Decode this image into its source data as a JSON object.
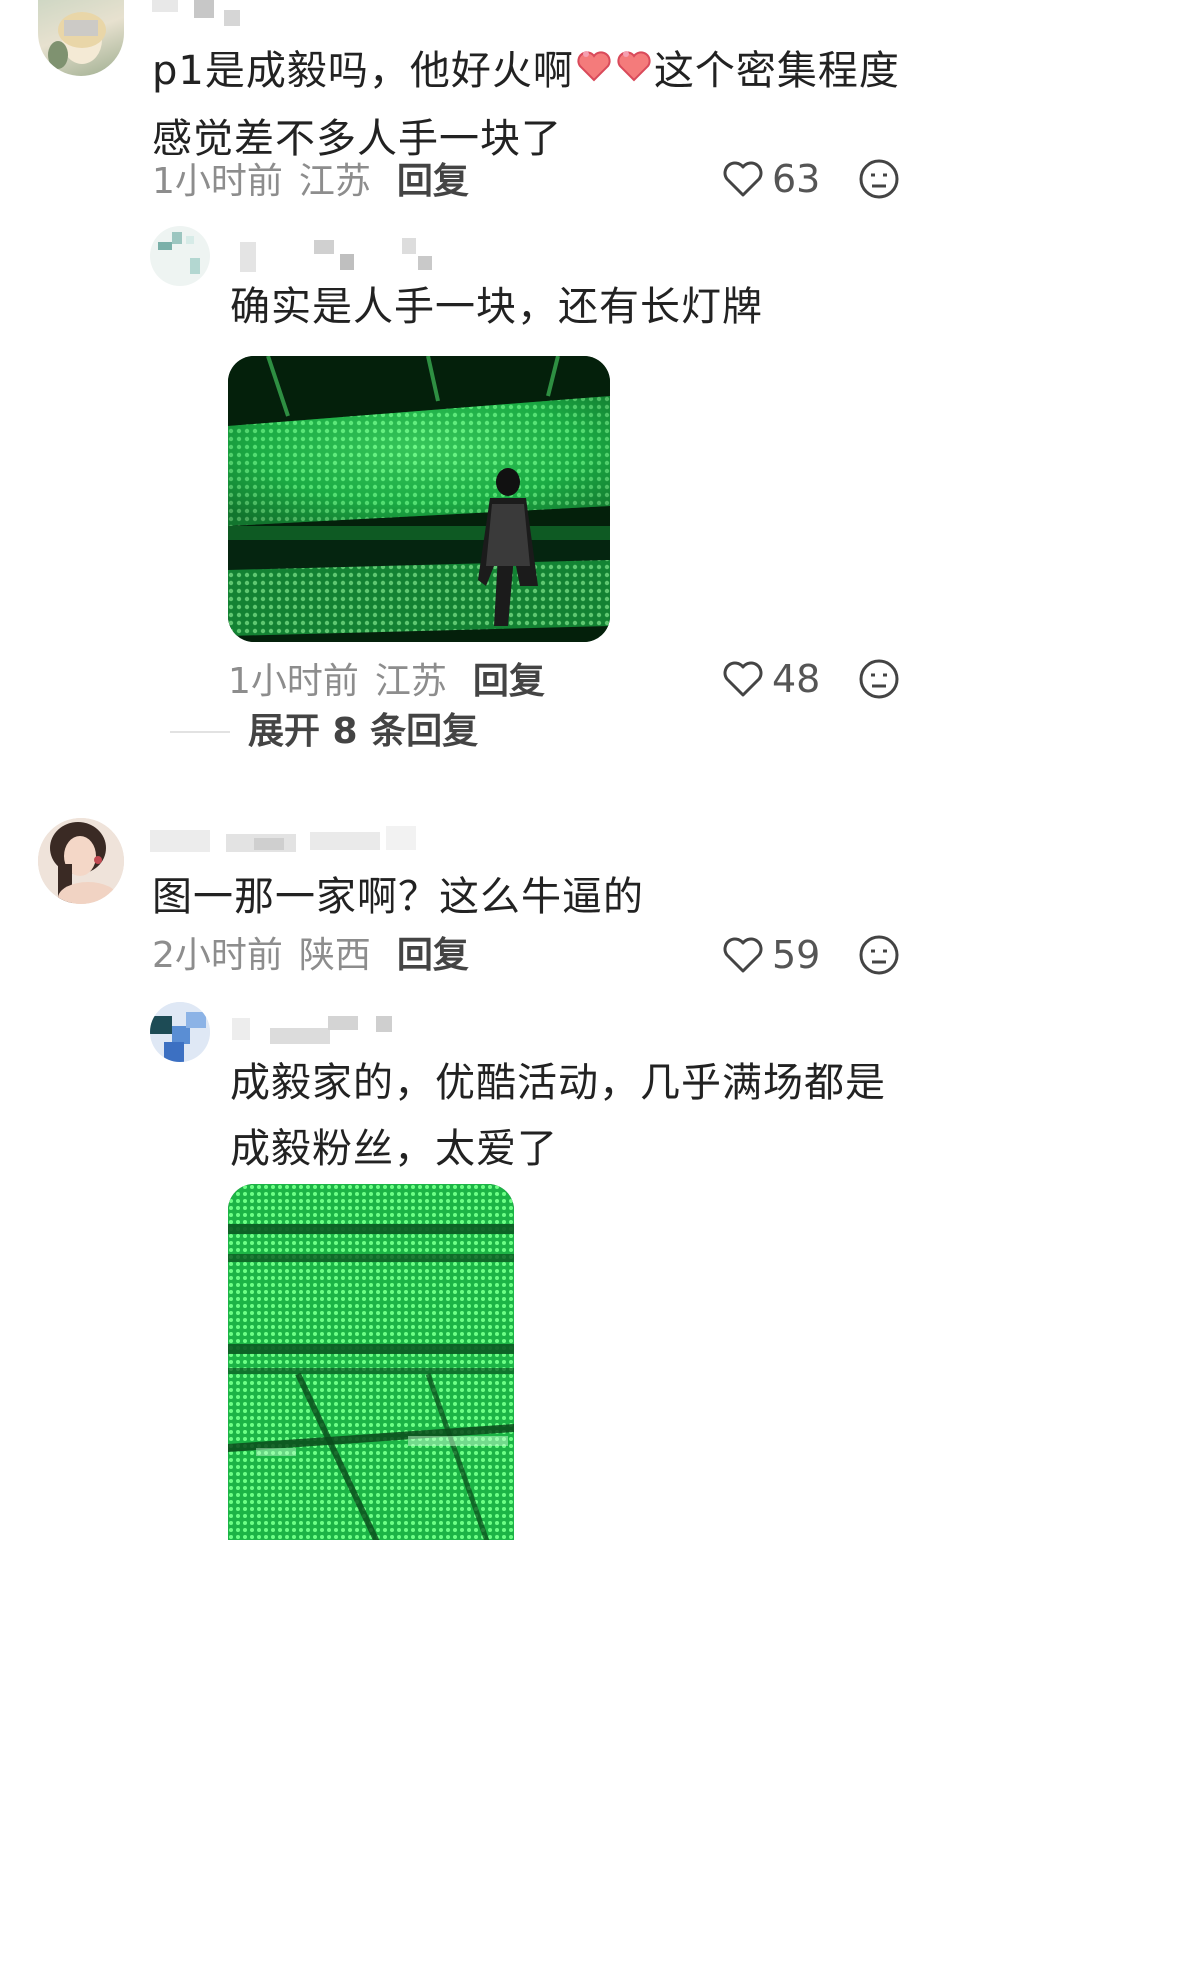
{
  "comments": [
    {
      "text": "p1是成毅吗，他好火啊",
      "text_after_emoji": "这个密集程度感觉差不多人手一块了",
      "time": "1小时前",
      "location": "江苏",
      "reply_label": "回复",
      "likes": "63",
      "avatar_icon": "blonde-girl-avatar",
      "replies": [
        {
          "text": "确实是人手一块，还有长灯牌",
          "time": "1小时前",
          "location": "江苏",
          "reply_label": "回复",
          "likes": "48",
          "avatar_icon": "flower-avatar",
          "has_image": true
        }
      ],
      "expand_label": "展开 8 条回复"
    },
    {
      "text": "图一那一家啊？这么牛逼的",
      "time": "2小时前",
      "location": "陕西",
      "reply_label": "回复",
      "likes": "59",
      "avatar_icon": "woman-portrait-avatar",
      "replies": [
        {
          "text": "成毅家的，优酷活动，几乎满场都是成毅粉丝，太爱了",
          "avatar_icon": "blue-sky-avatar",
          "has_image": true
        }
      ]
    }
  ],
  "colors": {
    "stadium_green": "#2fd35a",
    "dark_green": "#0b3d16",
    "meta_gray": "#8d8d8d"
  }
}
